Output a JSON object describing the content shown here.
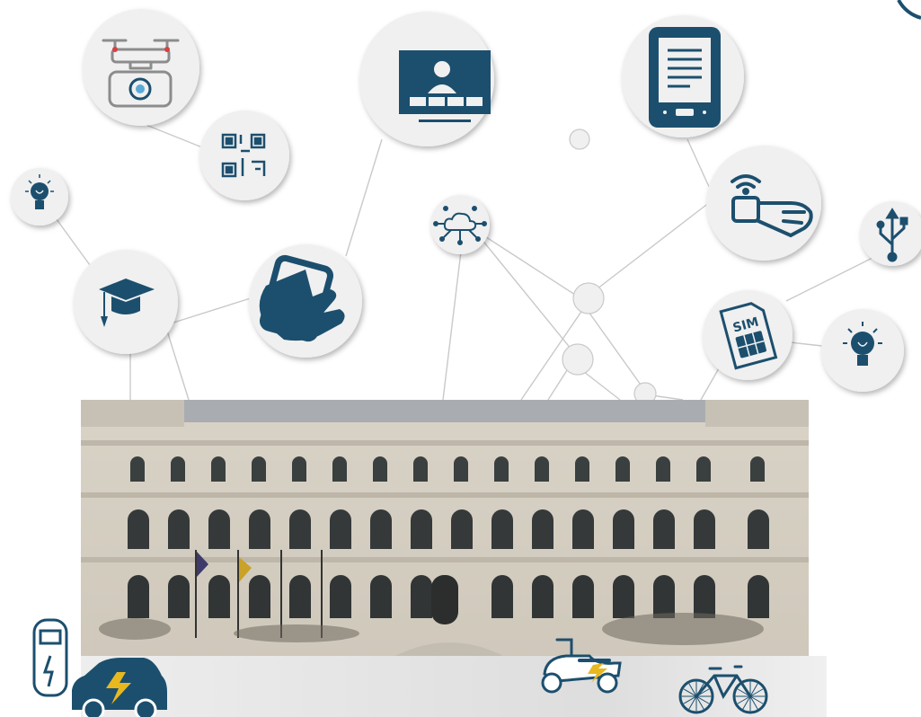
{
  "colors": {
    "icon_navy": "#1c4f6e",
    "node_fill": "#f0f0f0",
    "connector": "#c9c9c9",
    "drone_marker": "#d94040",
    "ground_shadow": "#b5b5b5"
  },
  "icons": [
    "drone-camera-icon",
    "qr-code-icon",
    "lightbulb-icon",
    "graduation-cap-icon",
    "smartphone-in-hand-icon",
    "video-conference-icon",
    "cloud-network-icon",
    "ebook-reader-icon",
    "smartwatch-wifi-icon",
    "usb-icon",
    "sim-card-icon",
    "charging-station-icon",
    "electric-car-icon",
    "electric-scooter-icon",
    "bicycle-icon"
  ],
  "labels": {
    "sim_card": "SIM"
  }
}
